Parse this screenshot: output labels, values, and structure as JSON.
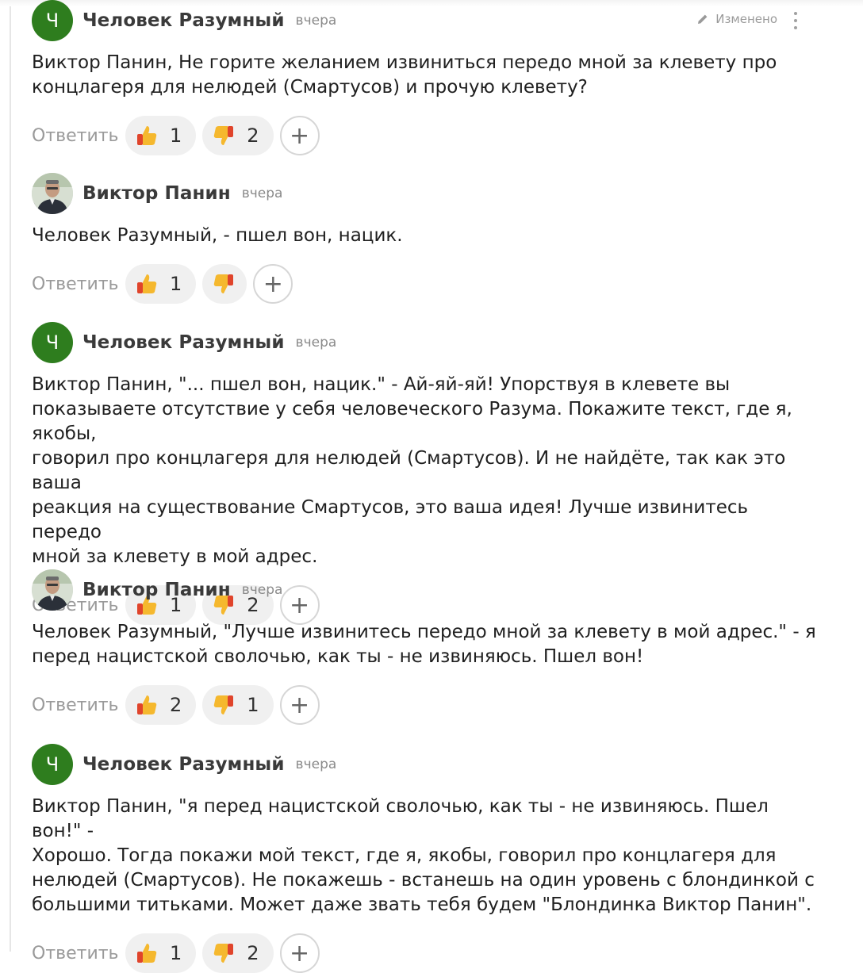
{
  "comments": [
    {
      "author": "Человек Разумный",
      "avatar_letter": "Ч",
      "time": "вчера",
      "edited_label": "Изменено",
      "text": "Виктор Панин, Не горите желанием извиниться передо мной за клевету про\nконцлагеря для нелюдей (Смартусов) и прочую клевету?",
      "reply_label": "Ответить",
      "likes": "1",
      "dislikes": "2"
    },
    {
      "author": "Виктор Панин",
      "time": "вчера",
      "text": "Человек Разумный, - пшел вон, нацик.",
      "reply_label": "Ответить",
      "likes": "1",
      "dislikes": ""
    },
    {
      "author": "Человек Разумный",
      "avatar_letter": "Ч",
      "time": "вчера",
      "text": "Виктор Панин, \"... пшел вон, нацик.\" - Ай-яй-яй! Упорствуя в клевете вы\nпоказываете отсутствие у себя человеческого Разума. Покажите текст, где я, якобы,\nговорил про концлагеря для нелюдей (Смартусов). И не найдёте, так как это ваша\nреакция на существование Смартусов, это ваша идея! Лучше извинитесь передо\nмной за клевету в мой адрес.",
      "reply_label": "Ответить",
      "likes": "1",
      "dislikes": "2"
    },
    {
      "author": "Виктор Панин",
      "time": "вчера",
      "text": "Человек Разумный, \"Лучше извинитесь передо мной за клевету в мой адрес.\" - я\nперед нацистской сволочью, как ты - не извиняюсь. Пшел вон!",
      "reply_label": "Ответить",
      "likes": "2",
      "dislikes": "1"
    },
    {
      "author": "Человек Разумный",
      "avatar_letter": "Ч",
      "time": "вчера",
      "text": "Виктор Панин, \"я перед нацистской сволочью, как ты - не извиняюсь. Пшел вон!\" -\nХорошо. Тогда покажи мой текст, где я, якобы, говорил про концлагеря для\nнелюдей (Смартусов). Не покажешь - встанешь на один уровень с блондинкой с\nбольшими титьками. Может даже звать тебя будем \"Блондинка Виктор Панин\".",
      "reply_label": "Ответить",
      "likes": "1",
      "dislikes": "2"
    }
  ],
  "colors": {
    "avatar_green": "#2e7d1e",
    "emoji_yellow": "#f5b82e",
    "emoji_red": "#e0442b"
  },
  "icons": {
    "like": "thumbs-up-icon",
    "dislike": "thumbs-down-icon",
    "add": "plus-icon",
    "edit": "pencil-icon",
    "more": "kebab-menu-icon"
  }
}
